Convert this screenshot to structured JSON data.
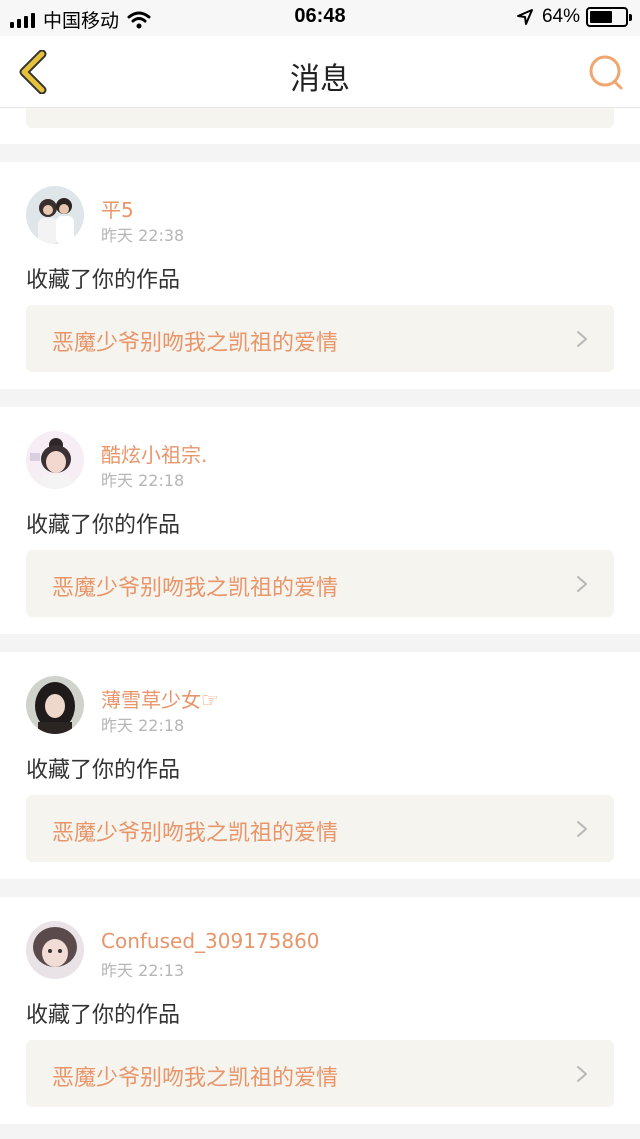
{
  "status_bar": {
    "carrier": "中国移动",
    "time": "06:48",
    "battery_percent": "64%",
    "battery_level": 0.64
  },
  "nav": {
    "title": "消息",
    "back_icon": "chevron-left-icon",
    "search_icon": "search-icon"
  },
  "notifications": [
    {
      "user": "平5",
      "time": "昨天 22:38",
      "action": "收藏了你的作品",
      "work_title": "恶魔少爷别吻我之凯祖的爱情"
    },
    {
      "user": "酷炫小祖宗.",
      "time": "昨天 22:18",
      "action": "收藏了你的作品",
      "work_title": "恶魔少爷别吻我之凯祖的爱情"
    },
    {
      "user": "薄雪草少女☞",
      "time": "昨天 22:18",
      "action": "收藏了你的作品",
      "work_title": "恶魔少爷别吻我之凯祖的爱情"
    },
    {
      "user": "Confused_309175860",
      "time": "昨天 22:13",
      "action": "收藏了你的作品",
      "work_title": "恶魔少爷别吻我之凯祖的爱情"
    }
  ],
  "colors": {
    "accent": "#e8956a",
    "nav_back": "#e6c23a",
    "card_bg": "#ffffff",
    "work_box_bg": "#f6f4ee"
  }
}
